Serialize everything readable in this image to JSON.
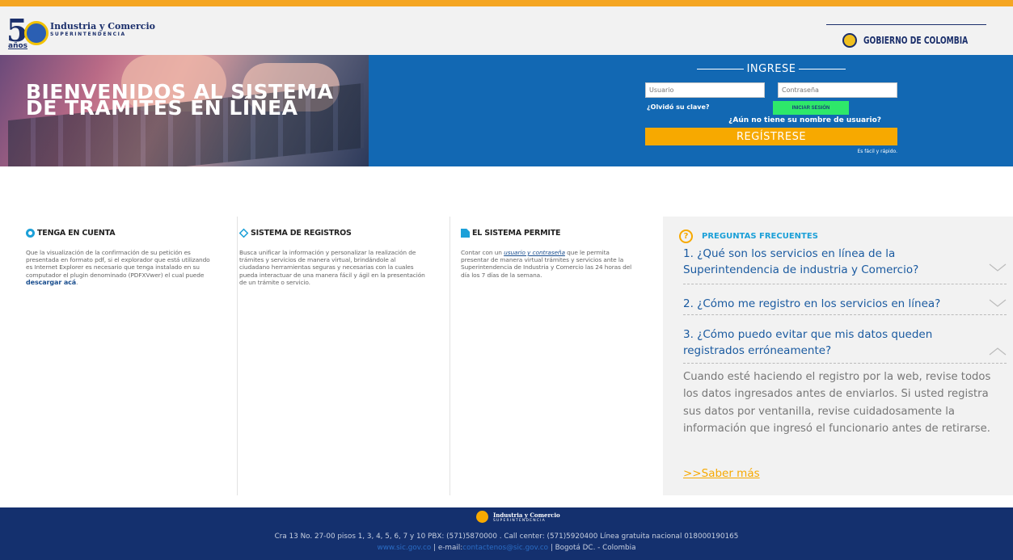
{
  "header": {
    "logo_number": "5",
    "logo_anos": "años",
    "logo_line1": "Industria y Comercio",
    "logo_line2": "SUPERINTENDENCIA",
    "gov_label": "GOBIERNO DE COLOMBIA"
  },
  "banner": {
    "title_line1": "BIENVENIDOS AL SISTEMA",
    "title_line2": "DE TRÁMITES EN LÍNEA"
  },
  "login": {
    "heading": "INGRESE",
    "username_placeholder": "Usuario",
    "password_placeholder": "Contraseña",
    "forgot_label": "¿Olvidó su clave?",
    "login_button": "INICIAR SESIÓN",
    "no_user_text": "¿Aún no tiene su nombre de usuario?",
    "register_button": "REGÍSTRESE",
    "easy_text": "Es fácil y rápido."
  },
  "columns": [
    {
      "title": "TENGA EN CUENTA",
      "icon": "eye-icon",
      "text": "Que la visualización de la confirmación de su petición es presentada en formato pdf, si el explorador que está utilizando es Internet Explorer es necesario que tenga instalado en su computador el plugin denominado (PDFXVwer) el cual puede ",
      "link": "descargar acá",
      "text_end": "."
    },
    {
      "title": "SISTEMA DE REGISTROS",
      "icon": "layers-icon",
      "text": "Busca unificar la información y personalizar la realización de trámites y servicios de manera virtual, brindándole al ciudadano herramientas seguras y necesarias con la cuales pueda interactuar de una manera fácil y ágil en la presentación de un trámite o servicio."
    },
    {
      "title": "EL SISTEMA PERMITE",
      "icon": "file-icon",
      "text_start": "Contar con un ",
      "emphasis": "usuario y contraseña",
      "text_end": " que le permita presentar de manera virtual trámites y servicios ante la Superintendencia de Industria y Comercio las 24 horas del día los 7 días de la semana."
    }
  ],
  "faq": {
    "title": "PREGUNTAS FRECUENTES",
    "q_icon": "?",
    "items": [
      {
        "question": "1. ¿Qué son los servicios en línea de la Superintendencia de industria y Comercio?",
        "state": "collapsed"
      },
      {
        "question": "2. ¿Cómo me registro en los servicios en línea?",
        "state": "collapsed"
      },
      {
        "question": "3. ¿Cómo puedo evitar que mis datos queden registrados erróneamente?",
        "state": "expanded"
      }
    ],
    "answer": "Cuando esté haciendo el registro por la web, revise todos los datos ingresados antes de enviarlos. Si usted registra sus datos por ventanilla, revise cuidadosamente la información que ingresó el funcionario antes de retirarse.",
    "more_link": ">>Saber más"
  },
  "footer": {
    "logo_line1": "Industria y Comercio",
    "logo_line2": "SUPERINTENDENCIA",
    "address": "Cra 13 No. 27-00 pisos 1, 3, 4, 5, 6, 7 y 10 PBX: (571)5870000 . Call center: (571)5920400 Línea gratuita nacional 018000190165",
    "website": "www.sic.gov.co",
    "email_label": " | e-mail:",
    "email": "contactenos@sic.gov.co",
    "city": " | Bogotá DC. - Colombia"
  },
  "colors": {
    "accent_orange": "#f7a900",
    "banner_blue": "#1268b3",
    "footer_navy": "#14306e",
    "link_blue": "#1a5aa0",
    "cyan": "#1ca0d8",
    "login_green": "#2ee86a"
  }
}
